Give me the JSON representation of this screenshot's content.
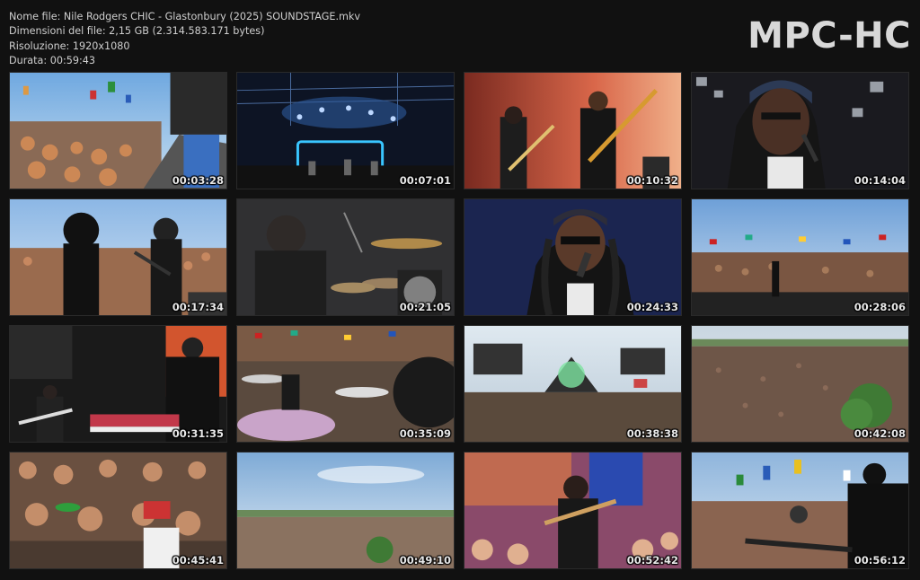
{
  "file_info": {
    "name_line": "Nome file: Nile Rodgers CHIC - Glastonbury (2025) SOUNDSTAGE.mkv",
    "size_line": "Dimensioni del file: 2,15 GB (2.314.583.171 bytes)",
    "resolution_line": "Risoluzione: 1920x1080",
    "duration_line": "Durata: 00:59:43"
  },
  "brand": "MPC-HC",
  "thumbnails": [
    {
      "time": "00:03:28",
      "scene": "crowd-flags-daylight"
    },
    {
      "time": "00:07:01",
      "scene": "stage-blue-lights"
    },
    {
      "time": "00:10:32",
      "scene": "guitar-bass-players-red"
    },
    {
      "time": "00:14:04",
      "scene": "closeup-singer-bandana"
    },
    {
      "time": "00:17:34",
      "scene": "singers-front-crowd"
    },
    {
      "time": "00:21:05",
      "scene": "drummer-kit"
    },
    {
      "time": "00:24:33",
      "scene": "closeup-singer-sunglasses"
    },
    {
      "time": "00:28:06",
      "scene": "crowd-flags-stage"
    },
    {
      "time": "00:31:35",
      "scene": "keyboard-player-stage"
    },
    {
      "time": "00:35:09",
      "scene": "drummer-cymbals-crowd"
    },
    {
      "time": "00:38:38",
      "scene": "pyramid-stage-crowd"
    },
    {
      "time": "00:42:08",
      "scene": "huge-crowd-tree"
    },
    {
      "time": "00:45:41",
      "scene": "crowd-fans-closeup"
    },
    {
      "time": "00:49:10",
      "scene": "wide-field-sky"
    },
    {
      "time": "00:52:42",
      "scene": "guitarist-pink-stage"
    },
    {
      "time": "00:56:12",
      "scene": "guitarist-silhouette-flags"
    }
  ]
}
